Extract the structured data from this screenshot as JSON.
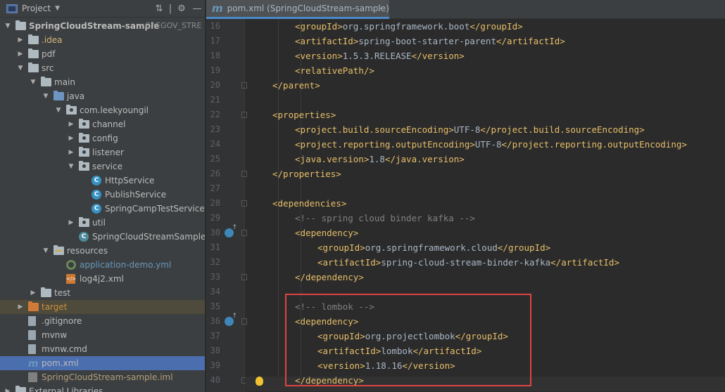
{
  "project_panel": {
    "title": "Project",
    "tree": [
      {
        "label": "SpringCloudStream-sample",
        "hint": "C:\\EGOV_STRE",
        "level": 0,
        "expanded": true,
        "icon": "folder-icon",
        "bold": true
      },
      {
        "label": ".idea",
        "level": 1,
        "expanded": false,
        "icon": "folder-icon",
        "color": "yellow"
      },
      {
        "label": "pdf",
        "level": 1,
        "expanded": false,
        "icon": "folder-icon"
      },
      {
        "label": "src",
        "level": 1,
        "expanded": true,
        "icon": "folder-icon"
      },
      {
        "label": "main",
        "level": 2,
        "expanded": true,
        "icon": "folder-icon"
      },
      {
        "label": "java",
        "level": 3,
        "expanded": true,
        "icon": "source-folder-icon"
      },
      {
        "label": "com.leekyoungil",
        "level": 4,
        "expanded": true,
        "icon": "package-icon"
      },
      {
        "label": "channel",
        "level": 5,
        "expanded": false,
        "icon": "package-icon"
      },
      {
        "label": "config",
        "level": 5,
        "expanded": false,
        "icon": "package-icon"
      },
      {
        "label": "listener",
        "level": 5,
        "expanded": false,
        "icon": "package-icon"
      },
      {
        "label": "service",
        "level": 5,
        "expanded": true,
        "icon": "package-icon"
      },
      {
        "label": "HttpService",
        "level": 6,
        "icon": "class-icon"
      },
      {
        "label": "PublishService",
        "level": 6,
        "icon": "class-icon"
      },
      {
        "label": "SpringCampTestService",
        "level": 6,
        "icon": "class-icon"
      },
      {
        "label": "util",
        "level": 5,
        "expanded": false,
        "icon": "package-icon"
      },
      {
        "label": "SpringCloudStreamSampleAp",
        "level": 5,
        "icon": "spring-class-icon"
      },
      {
        "label": "resources",
        "level": 3,
        "expanded": true,
        "icon": "resources-folder-icon"
      },
      {
        "label": "application-demo.yml",
        "level": 4,
        "icon": "yml-icon",
        "color": "blue"
      },
      {
        "label": "log4j2.xml",
        "level": 4,
        "icon": "xml-icon"
      },
      {
        "label": "test",
        "level": 2,
        "expanded": false,
        "icon": "folder-icon"
      },
      {
        "label": "target",
        "level": 1,
        "expanded": false,
        "icon": "excluded-folder-icon",
        "color": "orange"
      },
      {
        "label": ".gitignore",
        "level": 1,
        "icon": "file-icon"
      },
      {
        "label": "mvnw",
        "level": 1,
        "icon": "file-icon"
      },
      {
        "label": "mvnw.cmd",
        "level": 1,
        "icon": "file-icon"
      },
      {
        "label": "pom.xml",
        "level": 1,
        "icon": "maven-icon",
        "selected": true
      },
      {
        "label": "SpringCloudStream-sample.iml",
        "level": 1,
        "icon": "iml-icon",
        "color": "gold"
      },
      {
        "label": "External Libraries",
        "level": 0,
        "expanded": false,
        "icon": "library-icon"
      }
    ]
  },
  "editor": {
    "tab_label": "pom.xml (SpringCloudStream-sample)",
    "lines": [
      {
        "n": "16",
        "indent": 2,
        "parts": [
          [
            "tag",
            "<groupId>"
          ],
          [
            "txt",
            "org.springframework.boot"
          ],
          [
            "tag",
            "</groupId>"
          ]
        ]
      },
      {
        "n": "17",
        "indent": 2,
        "parts": [
          [
            "tag",
            "<artifactId>"
          ],
          [
            "txt",
            "spring-boot-starter-parent"
          ],
          [
            "tag",
            "</artifactId>"
          ]
        ]
      },
      {
        "n": "18",
        "indent": 2,
        "parts": [
          [
            "tag",
            "<version>"
          ],
          [
            "txt",
            "1.5.3.RELEASE"
          ],
          [
            "tag",
            "</version>"
          ]
        ]
      },
      {
        "n": "19",
        "indent": 2,
        "parts": [
          [
            "tag",
            "<relativePath/>"
          ]
        ]
      },
      {
        "n": "20",
        "indent": 1,
        "parts": [
          [
            "tag",
            "</parent>"
          ]
        ],
        "fold": true
      },
      {
        "n": "21",
        "indent": 0,
        "parts": []
      },
      {
        "n": "22",
        "indent": 1,
        "parts": [
          [
            "tag",
            "<properties>"
          ]
        ],
        "fold": true
      },
      {
        "n": "23",
        "indent": 2,
        "parts": [
          [
            "tag",
            "<project.build.sourceEncoding>"
          ],
          [
            "txt",
            "UTF-8"
          ],
          [
            "tag",
            "</project.build.sourceEncoding>"
          ]
        ]
      },
      {
        "n": "24",
        "indent": 2,
        "parts": [
          [
            "tag",
            "<project.reporting.outputEncoding>"
          ],
          [
            "txt",
            "UTF-8"
          ],
          [
            "tag",
            "</project.reporting.outputEncoding>"
          ]
        ]
      },
      {
        "n": "25",
        "indent": 2,
        "parts": [
          [
            "tag",
            "<java.version>"
          ],
          [
            "txt",
            "1.8"
          ],
          [
            "tag",
            "</java.version>"
          ]
        ]
      },
      {
        "n": "26",
        "indent": 1,
        "parts": [
          [
            "tag",
            "</properties>"
          ]
        ],
        "fold": true
      },
      {
        "n": "27",
        "indent": 0,
        "parts": []
      },
      {
        "n": "28",
        "indent": 1,
        "parts": [
          [
            "tag",
            "<dependencies>"
          ]
        ],
        "fold": true
      },
      {
        "n": "29",
        "indent": 2,
        "parts": [
          [
            "cmt",
            "<!-- spring cloud binder kafka -->"
          ]
        ]
      },
      {
        "n": "30",
        "indent": 2,
        "parts": [
          [
            "tag",
            "<dependency>"
          ]
        ],
        "fold": true,
        "gutter_icon": true
      },
      {
        "n": "31",
        "indent": 3,
        "parts": [
          [
            "tag",
            "<groupId>"
          ],
          [
            "txt",
            "org.springframework.cloud"
          ],
          [
            "tag",
            "</groupId>"
          ]
        ]
      },
      {
        "n": "32",
        "indent": 3,
        "parts": [
          [
            "tag",
            "<artifactId>"
          ],
          [
            "txt",
            "spring-cloud-stream-binder-kafka"
          ],
          [
            "tag",
            "</artifactId>"
          ]
        ]
      },
      {
        "n": "33",
        "indent": 2,
        "parts": [
          [
            "tag",
            "</dependency>"
          ]
        ],
        "fold": true
      },
      {
        "n": "34",
        "indent": 0,
        "parts": []
      },
      {
        "n": "35",
        "indent": 2,
        "parts": [
          [
            "cmt",
            "<!-- lombok -->"
          ]
        ]
      },
      {
        "n": "36",
        "indent": 2,
        "parts": [
          [
            "tag",
            "<dependency>"
          ]
        ],
        "fold": true,
        "gutter_icon": true
      },
      {
        "n": "37",
        "indent": 3,
        "parts": [
          [
            "tag",
            "<groupId>"
          ],
          [
            "txt",
            "org.projectlombok"
          ],
          [
            "tag",
            "</groupId>"
          ]
        ]
      },
      {
        "n": "38",
        "indent": 3,
        "parts": [
          [
            "tag",
            "<artifactId>"
          ],
          [
            "txt",
            "lombok"
          ],
          [
            "tag",
            "</artifactId>"
          ]
        ]
      },
      {
        "n": "39",
        "indent": 3,
        "parts": [
          [
            "tag",
            "<version>"
          ],
          [
            "txt",
            "1.18.16"
          ],
          [
            "tag",
            "</version>"
          ]
        ]
      },
      {
        "n": "40",
        "indent": 2,
        "parts": [
          [
            "tag",
            "</dependency>"
          ]
        ],
        "fold": true
      }
    ]
  }
}
